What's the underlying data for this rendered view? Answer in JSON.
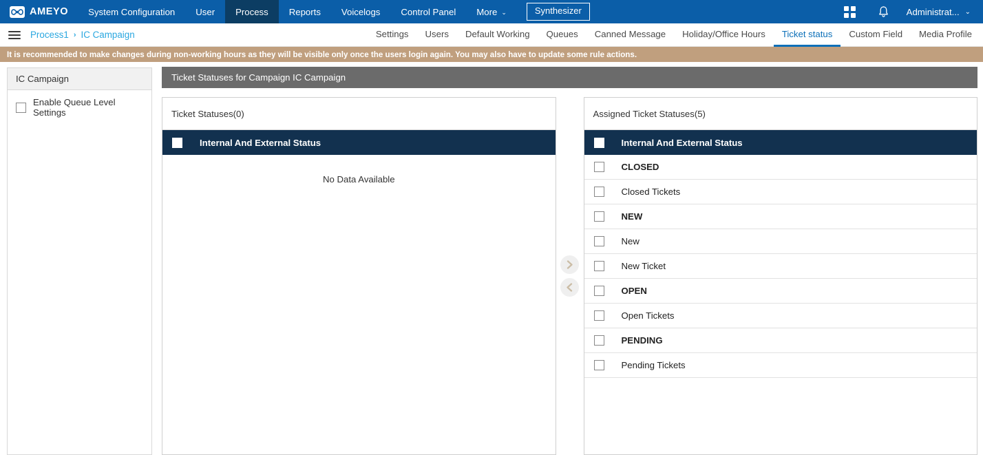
{
  "topnav": {
    "brand": "AMEYO",
    "items": [
      {
        "label": "System Configuration",
        "active": false
      },
      {
        "label": "User",
        "active": false
      },
      {
        "label": "Process",
        "active": true
      },
      {
        "label": "Reports",
        "active": false
      },
      {
        "label": "Voicelogs",
        "active": false
      },
      {
        "label": "Control Panel",
        "active": false
      },
      {
        "label": "More",
        "active": false,
        "caret": "⌄"
      }
    ],
    "synthesizer_label": "Synthesizer",
    "apps_icon": "grid-apps-icon",
    "notification_icon": "bell-icon",
    "user_label": "Administrat...",
    "user_caret": "⌄"
  },
  "subnav": {
    "menu_icon": "hamburger-menu-icon",
    "breadcrumb": [
      "Process1",
      "IC Campaign"
    ],
    "breadcrumb_separator": "›",
    "tabs": [
      {
        "label": "Settings",
        "active": false
      },
      {
        "label": "Users",
        "active": false
      },
      {
        "label": "Default Working",
        "active": false
      },
      {
        "label": "Queues",
        "active": false
      },
      {
        "label": "Canned Message",
        "active": false
      },
      {
        "label": "Holiday/Office Hours",
        "active": false
      },
      {
        "label": "Ticket status",
        "active": true
      },
      {
        "label": "Custom Field",
        "active": false
      },
      {
        "label": "Media Profile",
        "active": false
      }
    ]
  },
  "notice": {
    "text": "It is recommended to make changes during non-working hours as they will be visible only once the users login again. You may also have to update some rule actions.",
    "background": "#c09f7e"
  },
  "sidebar": {
    "title": "IC Campaign",
    "checkbox_label": "Enable Queue Level Settings",
    "checkbox_checked": false
  },
  "main": {
    "header": "Ticket Statuses for Campaign IC Campaign",
    "available": {
      "title": "Ticket Statuses(0)",
      "header_row": {
        "label": "Internal And External Status",
        "checked": false
      },
      "empty_message": "No Data Available",
      "rows": []
    },
    "assigned": {
      "title": "Assigned Ticket Statuses(5)",
      "header_row": {
        "label": "Internal And External Status",
        "checked": false
      },
      "rows": [
        {
          "label": "CLOSED",
          "group": true,
          "checked": false
        },
        {
          "label": "Closed Tickets",
          "group": false,
          "checked": false
        },
        {
          "label": "NEW",
          "group": true,
          "checked": false
        },
        {
          "label": "New",
          "group": false,
          "checked": false
        },
        {
          "label": "New Ticket",
          "group": false,
          "checked": false
        },
        {
          "label": "OPEN",
          "group": true,
          "checked": false
        },
        {
          "label": "Open Tickets",
          "group": false,
          "checked": false
        },
        {
          "label": "PENDING",
          "group": true,
          "checked": false
        },
        {
          "label": "Pending Tickets",
          "group": false,
          "checked": false
        }
      ]
    },
    "transfer": {
      "move_right_icon": "chevron-right-icon",
      "move_left_icon": "chevron-left-icon"
    }
  },
  "colors": {
    "nav_blue": "#0b5ea8",
    "nav_active": "#0c3d63",
    "accent_link": "#2aa7e0",
    "tab_active": "#0b6fb8",
    "panel_header": "#12314f",
    "main_header": "#6b6b6b",
    "notice": "#c09f7e"
  }
}
